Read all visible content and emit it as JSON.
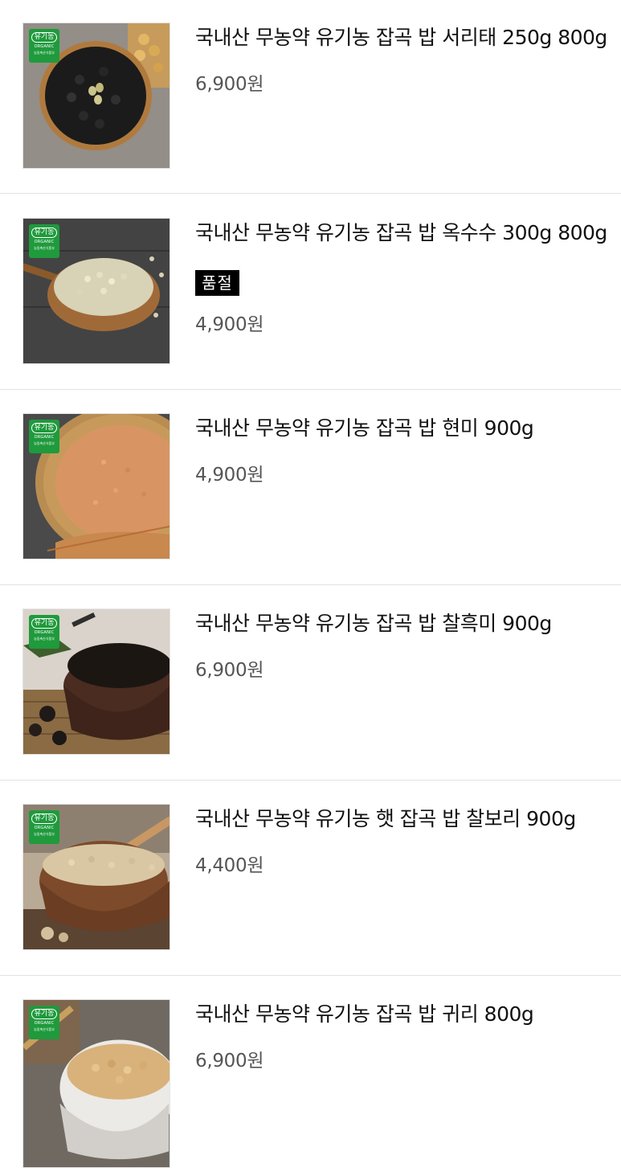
{
  "products": [
    {
      "title": "국내산 무농약 유기농 잡곡 밥 서리태 250g 800g",
      "price": "6,900원",
      "badge": {
        "label": "유기농",
        "sub": "ORGANIC",
        "cert": "농림축산식품부"
      },
      "image_icon": "black-soybean-bowl-image"
    },
    {
      "title": "국내산 무농약 유기농 잡곡 밥 옥수수 300g 800g",
      "price": "4,900원",
      "status_tag": "품절",
      "badge": {
        "label": "유기농",
        "sub": "ORGANIC",
        "cert": "농림축산식품부"
      },
      "image_icon": "corn-grain-spoon-image"
    },
    {
      "title": "국내산 무농약 유기농 잡곡 밥 현미 900g",
      "price": "4,900원",
      "badge": {
        "label": "유기농",
        "sub": "ORGANIC",
        "cert": "농림축산식품부"
      },
      "image_icon": "brown-rice-basket-image"
    },
    {
      "title": "국내산 무농약 유기농 잡곡 밥 찰흑미 900g",
      "price": "6,900원",
      "badge": {
        "label": "유기농",
        "sub": "ORGANIC",
        "cert": "농림축산식품부"
      },
      "image_icon": "black-rice-bowl-image"
    },
    {
      "title": "국내산 무농약 유기농 햇 잡곡 밥 찰보리 900g",
      "price": "4,400원",
      "badge": {
        "label": "유기농",
        "sub": "ORGANIC",
        "cert": "농림축산식품부"
      },
      "image_icon": "glutinous-barley-bowl-image"
    },
    {
      "title": "국내산 무농약 유기농 잡곡 밥 귀리 800g",
      "price": "6,900원",
      "badge": {
        "label": "유기농",
        "sub": "ORGANIC",
        "cert": "농림축산식품부"
      },
      "image_icon": "oat-bowl-image"
    }
  ],
  "colors": {
    "title_text": "#111111",
    "price_text": "#555555",
    "soldout_bg": "#000000",
    "badge_green": "#1f9a3c",
    "separator": "#e2e2e2"
  }
}
